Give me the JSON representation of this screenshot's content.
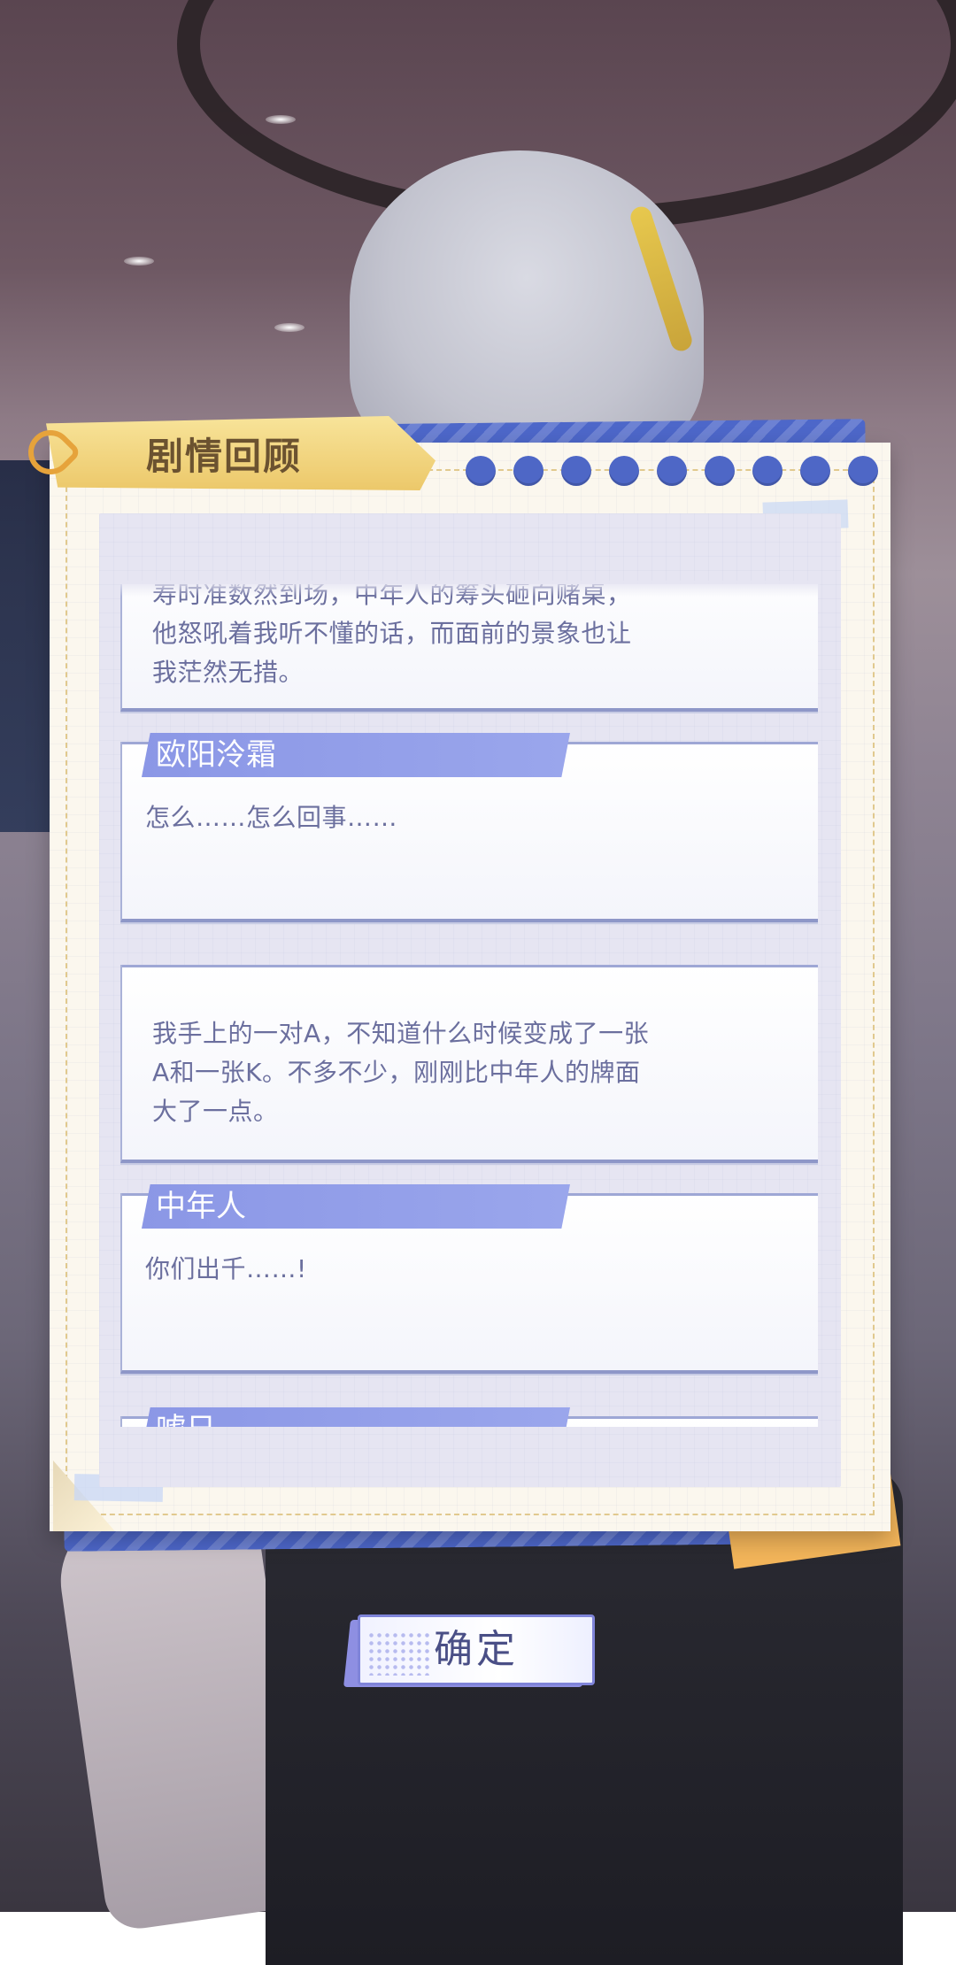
{
  "review": {
    "title": "剧情回顾",
    "entries": [
      {
        "speaker": "",
        "text": "寿时准数然到场，中年人的筹头砸向赌桌，\n他怒吼着我听不懂的话，而面前的景象也让\n我茫然无措。"
      },
      {
        "speaker": "欧阳泠霜",
        "text": "怎么……怎么回事……"
      },
      {
        "speaker": "",
        "text": "我手上的一对A，不知道什么时候变成了一张\nA和一张K。不多不少，刚刚比中年人的牌面\n大了一点。"
      },
      {
        "speaker": "中年人",
        "text": "你们出千……!"
      },
      {
        "speaker": "嘘日",
        "text": ""
      }
    ]
  },
  "confirm_label": "确定",
  "colors": {
    "panel_blue": "#4d67c9",
    "speaker_tag": "#8b97e6",
    "title_tab": "#f0d37a",
    "text": "#6b6f9e"
  }
}
